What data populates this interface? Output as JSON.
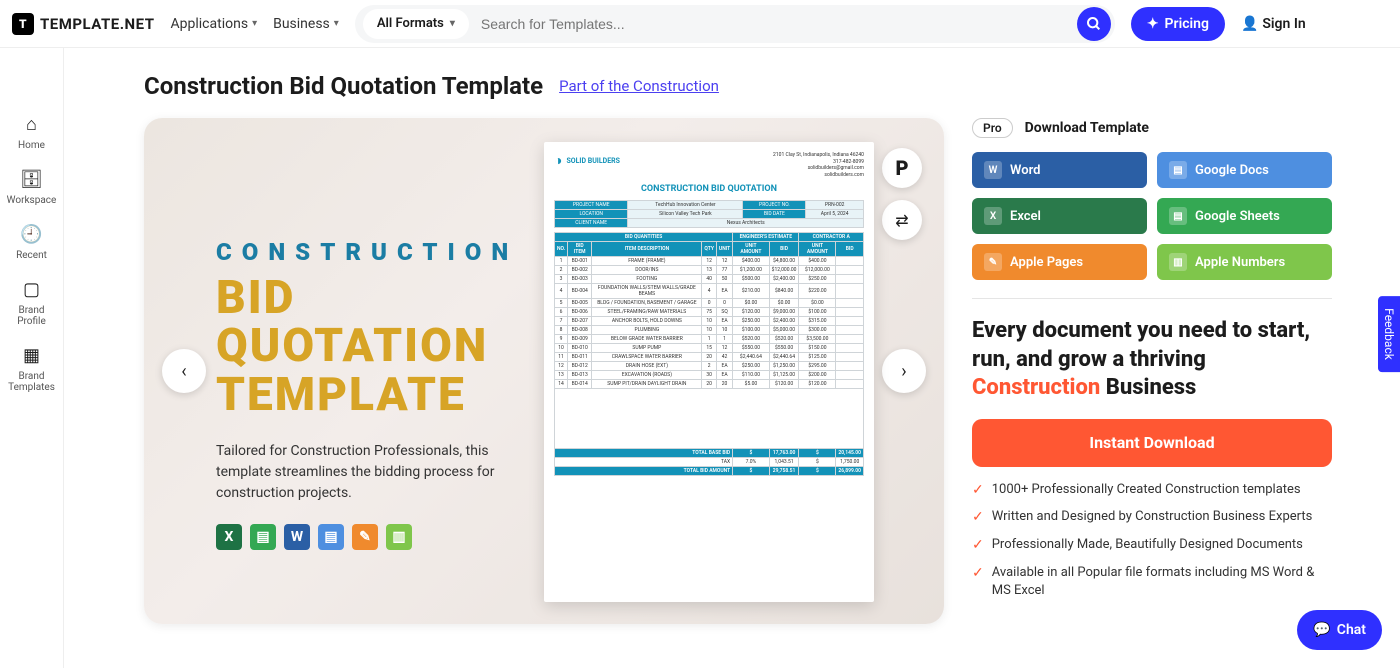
{
  "header": {
    "logo": "TEMPLATE.NET",
    "nav": {
      "applications": "Applications",
      "business": "Business"
    },
    "formats_label": "All Formats",
    "search_placeholder": "Search for Templates...",
    "pricing": "Pricing",
    "signin": "Sign In"
  },
  "leftbar": {
    "home": "Home",
    "workspace": "Workspace",
    "recent": "Recent",
    "brand_profile": "Brand\nProfile",
    "brand_templates": "Brand\nTemplates"
  },
  "page": {
    "title": "Construction Bid Quotation Template",
    "part_of": "Part of the Construction"
  },
  "preview": {
    "line1": "CONSTRUCTION",
    "line2": "BID",
    "line3": "QUOTATION",
    "line4": "TEMPLATE",
    "tagline": "Tailored for Construction Professionals, this template streamlines the bidding process for construction projects."
  },
  "doc": {
    "company": "SOLID BUILDERS",
    "addr1": "2101 Clay St, Indianapolis, Indiana 46240",
    "addr2": "317-482-8099",
    "addr3": "solidbuilders@gmail.com",
    "addr4": "solidbuilders.com",
    "title": "CONSTRUCTION BID QUOTATION",
    "info": {
      "project_name_l": "PROJECT NAME",
      "project_name_v": "TechHub Innovation Center",
      "project_no_l": "PROJECT NO.",
      "project_no_v": "PRN-002",
      "location_l": "LOCATION",
      "location_v": "Silicon Valley Tech Park",
      "bid_date_l": "BID DATE",
      "bid_date_v": "April 5, 2024",
      "client_l": "CLIENT NAME",
      "client_v": "Nexus Architects"
    },
    "section_headers": {
      "qty": "BID QUANTITIES",
      "eng": "ENGINEER'S ESTIMATE",
      "con": "CONTRACTOR A"
    },
    "columns": [
      "NO.",
      "BID ITEM",
      "ITEM DESCRIPTION",
      "QTY",
      "UNIT",
      "UNIT AMOUNT",
      "BID",
      "UNIT AMOUNT",
      "BID"
    ],
    "rows": [
      [
        "1",
        "BD-001",
        "FRAME (FRAME)",
        "12",
        "12",
        "$400.00",
        "$4,800.00",
        "$400.00"
      ],
      [
        "2",
        "BD-002",
        "DOOR/INS",
        "13",
        "77",
        "$1,200.00",
        "$12,000.00",
        "$12,000.00"
      ],
      [
        "3",
        "BD-003",
        "FOOTING",
        "40",
        "50",
        "$500.00",
        "$2,400.00",
        "$250.00"
      ],
      [
        "4",
        "BD-004",
        "FOUNDATION WALLS/STEM WALLS/GRADE BEAMS",
        "4",
        "EA",
        "$210.00",
        "$840.00",
        "$220.00"
      ],
      [
        "5",
        "BD-005",
        "BLDG / FOUNDATION, BASEMENT / GARAGE",
        "0",
        "0",
        "$0.00",
        "$0.00",
        "$0.00"
      ],
      [
        "6",
        "BD-006",
        "STEEL/FRAMING/RAW MATERIALS",
        "75",
        "SQ",
        "$120.00",
        "$9,000.00",
        "$100.00"
      ],
      [
        "7",
        "BD-207",
        "ANCHOR BOLTS, HOLD DOWNS",
        "10",
        "EA",
        "$250.00",
        "$2,400.00",
        "$315.00"
      ],
      [
        "8",
        "BD-008",
        "PLUMBING",
        "10",
        "10",
        "$100.00",
        "$5,000.00",
        "$300.00"
      ],
      [
        "9",
        "BD-009",
        "BELOW GRADE WATER BARRIER",
        "1",
        "1",
        "$520.00",
        "$520.00",
        "$3,500.00"
      ],
      [
        "10",
        "BD-010",
        "SUMP PUMP",
        "15",
        "12",
        "$550.00",
        "$550.00",
        "$150.00"
      ],
      [
        "11",
        "BD-011",
        "CRAWLSPACE WATER BARRIER",
        "20",
        "42",
        "$2,440.64",
        "$2,440.64",
        "$125.00"
      ],
      [
        "12",
        "BD-012",
        "DRAIN HOSE (EXT)",
        "2",
        "EA",
        "$250.00",
        "$1,250.00",
        "$295.00"
      ],
      [
        "13",
        "BD-013",
        "EXCAVATION (ROADS)",
        "30",
        "EA",
        "$110.00",
        "$1,125.00",
        "$200.00"
      ],
      [
        "14",
        "BD-014",
        "SUMP PIT/DRAIN DAYLIGHT DRAIN",
        "20",
        "20",
        "$5.00",
        "$120.00",
        "$120.00"
      ]
    ],
    "totals": {
      "base_l": "TOTAL BASE BID",
      "base_v1": "$",
      "base_v2": "17,763.00",
      "base_v3": "$",
      "base_v4": "20,145.00",
      "pct": "7.0%",
      "pct_v1": "$",
      "pct_v2": "1,043.51",
      "pct_v3": "$",
      "pct_v4": "1,750.00",
      "amount_l": "TOTAL BID AMOUNT",
      "amount_v1": "$",
      "amount_v2": "29,758.51",
      "amount_v3": "$",
      "amount_v4": "26,899.00"
    }
  },
  "side": {
    "pro": "Pro",
    "download_template": "Download Template",
    "buttons": {
      "word": "Word",
      "gdocs": "Google Docs",
      "excel": "Excel",
      "gsheets": "Google Sheets",
      "apages": "Apple Pages",
      "anumbers": "Apple Numbers"
    },
    "promo_a": "Every document you need to start, run, and grow a thriving ",
    "promo_b": "Construction",
    "promo_c": " Business",
    "instant": "Instant Download",
    "benefits": [
      "1000+ Professionally Created Construction templates",
      "Written and Designed by Construction Business Experts",
      "Professionally Made, Beautifully Designed Documents",
      "Available in all Popular file formats including MS Word & MS Excel"
    ]
  },
  "misc": {
    "feedback": "Feedback",
    "chat": "Chat"
  },
  "colors": {
    "word": "#2b5fa5",
    "gdocs": "#4e8fe0",
    "excel": "#2a7a4b",
    "gsheets": "#34a853",
    "apages": "#f08a2d",
    "anumbers": "#7fc64b"
  }
}
